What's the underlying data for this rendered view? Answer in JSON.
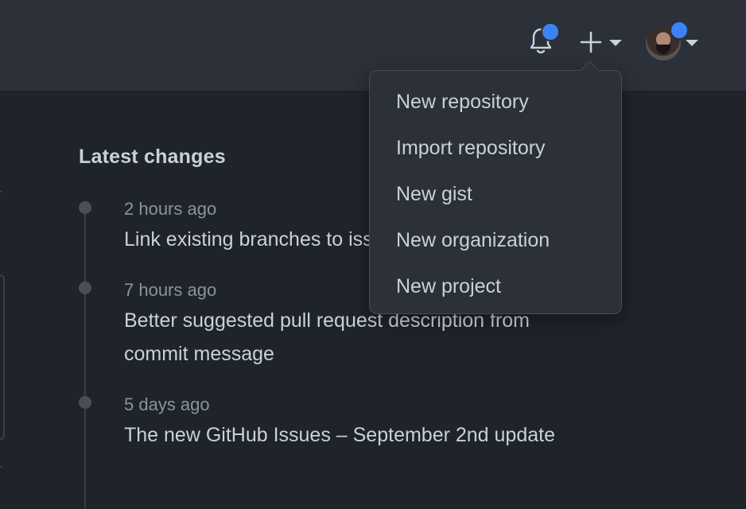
{
  "header": {
    "notifications_icon": "bell-icon",
    "create_icon": "plus-icon",
    "avatar_icon": "user-avatar",
    "accent_color": "#3b82f6"
  },
  "create_menu": {
    "items": [
      {
        "label": "New repository"
      },
      {
        "label": "Import repository"
      },
      {
        "label": "New gist"
      },
      {
        "label": "New organization"
      },
      {
        "label": "New project"
      }
    ]
  },
  "latest_changes": {
    "title": "Latest changes",
    "items": [
      {
        "time": "2 hours ago",
        "text": "Link existing branches to issues"
      },
      {
        "time": "7 hours ago",
        "text": "Better suggested pull request description from commit message"
      },
      {
        "time": "5 days ago",
        "text": "The new GitHub Issues – September 2nd update"
      }
    ]
  }
}
